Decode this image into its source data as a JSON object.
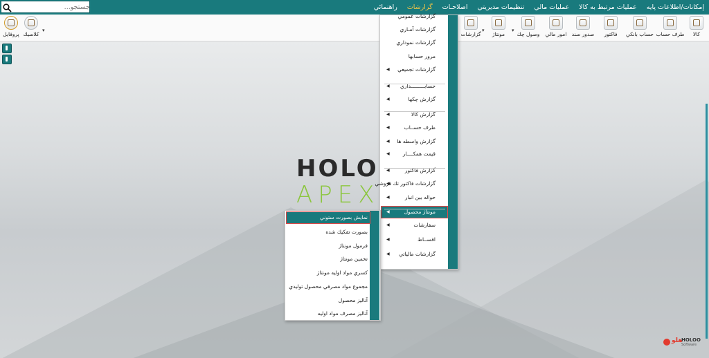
{
  "topbar": {
    "menu": [
      "إمكانات/اطلاعات پايه",
      "عمليات مرتبط به كالا",
      "عمليات مالي",
      "تنظيمات مديريتي",
      "اصلاحـات",
      "گزارشات",
      "راهنمائي"
    ],
    "active_index": 5,
    "search_placeholder": "جستجو..."
  },
  "toolbar": {
    "buttons": [
      "كالا",
      "طرف حساب",
      "حساب بانكي",
      "فاكتور",
      "صدور سند",
      "امور مالي",
      "وصول چك",
      "مونتاژ",
      "گزارشات",
      "كلاسيك",
      "پروفايل"
    ]
  },
  "background": {
    "logo_line1": "HOLOO",
    "logo_line2": "APEX",
    "brand_fa": "هلو",
    "brand_en": "HOLOO",
    "brand_sub": "Software"
  },
  "reports_menu": {
    "items": [
      {
        "label": "گزارشات عمومي",
        "arrow": false
      },
      {
        "label": "گزارشات آمـاري",
        "arrow": false
      },
      {
        "label": "گزارشات نموداري",
        "arrow": false
      },
      {
        "label": "مرور حسابها",
        "arrow": false
      },
      {
        "label": "گزارشات تجميعي",
        "arrow": true
      },
      {
        "label": "حسابـــــــــداري",
        "arrow": true
      },
      {
        "label": "گزارش چكها",
        "arrow": true
      },
      {
        "label": "گزارش كالا",
        "arrow": true
      },
      {
        "label": "طرف حســاب",
        "arrow": true
      },
      {
        "label": "گزارش واسطه ها",
        "arrow": true
      },
      {
        "label": "قيمت همكــــار",
        "arrow": true
      },
      {
        "label": "گزارش فاكتور",
        "arrow": true
      },
      {
        "label": "گزارشات فاكتور تك فروشي",
        "arrow": true
      },
      {
        "label": "حواله بين انبار",
        "arrow": true
      },
      {
        "label": "مونتاژ محصول",
        "arrow": true
      },
      {
        "label": "سفارشات",
        "arrow": true
      },
      {
        "label": "اقســاط",
        "arrow": true
      },
      {
        "label": "گزارشات مالياتي",
        "arrow": true
      }
    ],
    "highlighted_index": 14
  },
  "montage_submenu": {
    "items": [
      "نمايش بصورت ستوني",
      "بصورت تفكيك شده",
      "فرمول مونتاژ",
      "تخمين مونتاژ",
      "كسري مواد اوليه مونتاژ",
      "مجموع مواد مصرفي محصول توليدي",
      "آناليز محصول",
      "آناليز مصرف مواد اوليه"
    ],
    "highlighted_index": 0
  },
  "colors": {
    "brand_teal": "#197a7d",
    "active_menu": "#f3c645",
    "highlight_border": "#e04848",
    "logo_green": "#8cc63f"
  }
}
